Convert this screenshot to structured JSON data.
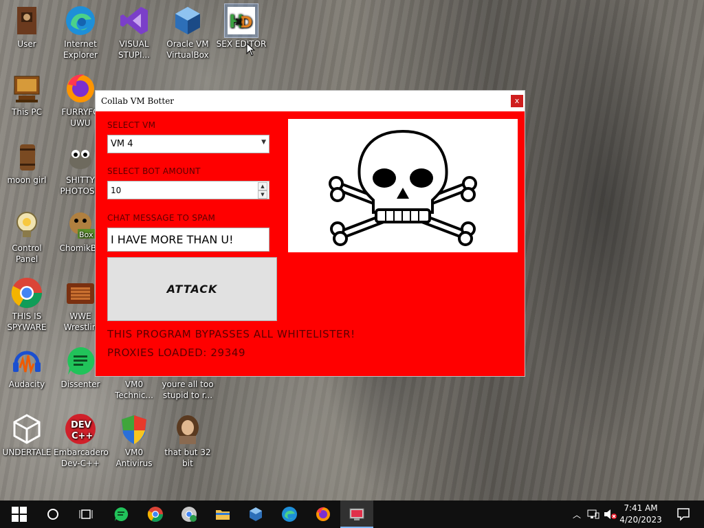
{
  "desktop": {
    "icons": [
      {
        "label": "User"
      },
      {
        "label": "Internet Explorer"
      },
      {
        "label": "VISUAL STUPI..."
      },
      {
        "label": "Oracle VM VirtualBox"
      },
      {
        "label": "SEX EDITOR"
      },
      {
        "label": "This PC"
      },
      {
        "label": "FURRYFO UWU"
      },
      {
        "label": "moon girl"
      },
      {
        "label": "SHITTY PHOTOSH"
      },
      {
        "label": "Control Panel"
      },
      {
        "label": "ChomikBo"
      },
      {
        "label": "THIS IS SPYWARE"
      },
      {
        "label": "WWE Wrestlin"
      },
      {
        "label": "Audacity"
      },
      {
        "label": "Dissenter"
      },
      {
        "label": "VM0 Technic..."
      },
      {
        "label": "youre all too stupid to r..."
      },
      {
        "label": "UNDERTALE"
      },
      {
        "label": "Embarcadero Dev-C++"
      },
      {
        "label": "VM0 Antivirus"
      },
      {
        "label": "that but 32 bit"
      }
    ]
  },
  "window": {
    "title": "Collab VM Botter",
    "close_label": "x",
    "select_vm_label": "SELECT VM",
    "select_vm_value": "VM 4",
    "bot_amount_label": "SELECT BOT AMOUNT",
    "bot_amount_value": "10",
    "chat_label": "CHAT MESSAGE TO SPAM",
    "chat_value": "I HAVE MORE THAN U!",
    "attack_label": "ATTACK",
    "bypass_text": "THIS PROGRAM BYPASSES ALL WHITELISTER!",
    "proxies_text": "PROXIES LOADED: 29349",
    "accent_color": "#ff0000"
  },
  "taskbar": {
    "items": [
      "start-icon",
      "search-icon",
      "task-view-icon",
      "dissenter-icon",
      "chrome-icon",
      "chrome-alt-icon",
      "file-explorer-icon",
      "virtualbox-icon",
      "edge-icon",
      "firefox-icon",
      "collab-vm-botter-icon"
    ],
    "time": "7:41 AM",
    "date": "4/20/2023"
  }
}
